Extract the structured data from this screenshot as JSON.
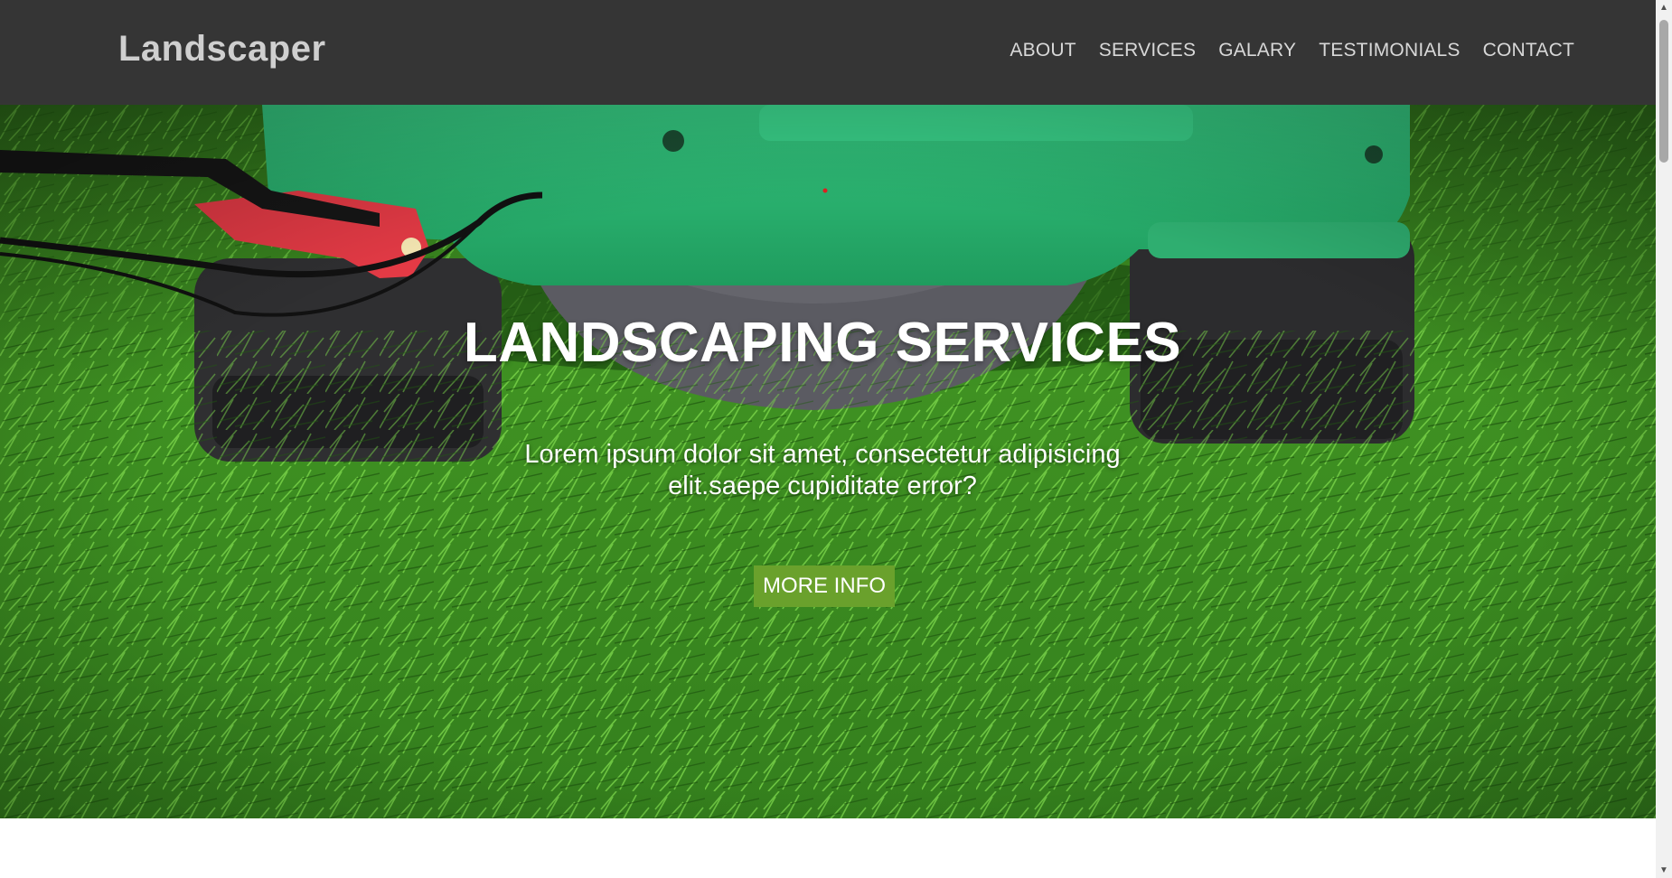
{
  "header": {
    "logo": "Landscaper",
    "nav": [
      {
        "label": "ABOUT"
      },
      {
        "label": "SERVICES"
      },
      {
        "label": "GALARY"
      },
      {
        "label": "TESTIMONIALS"
      },
      {
        "label": "CONTACT"
      }
    ]
  },
  "hero": {
    "title": "LANDSCAPING SERVICES",
    "text": "Lorem ipsum dolor sit amet, consectetur adipisicing elit.saepe cupiditate error?",
    "button_label": "MORE INFO",
    "background_image": "lawn-mower-on-grass"
  },
  "colors": {
    "navbar_bg": "#353535",
    "accent": "#6aa12c",
    "grass": "#3d8f1f",
    "mower": "#2fb872"
  }
}
